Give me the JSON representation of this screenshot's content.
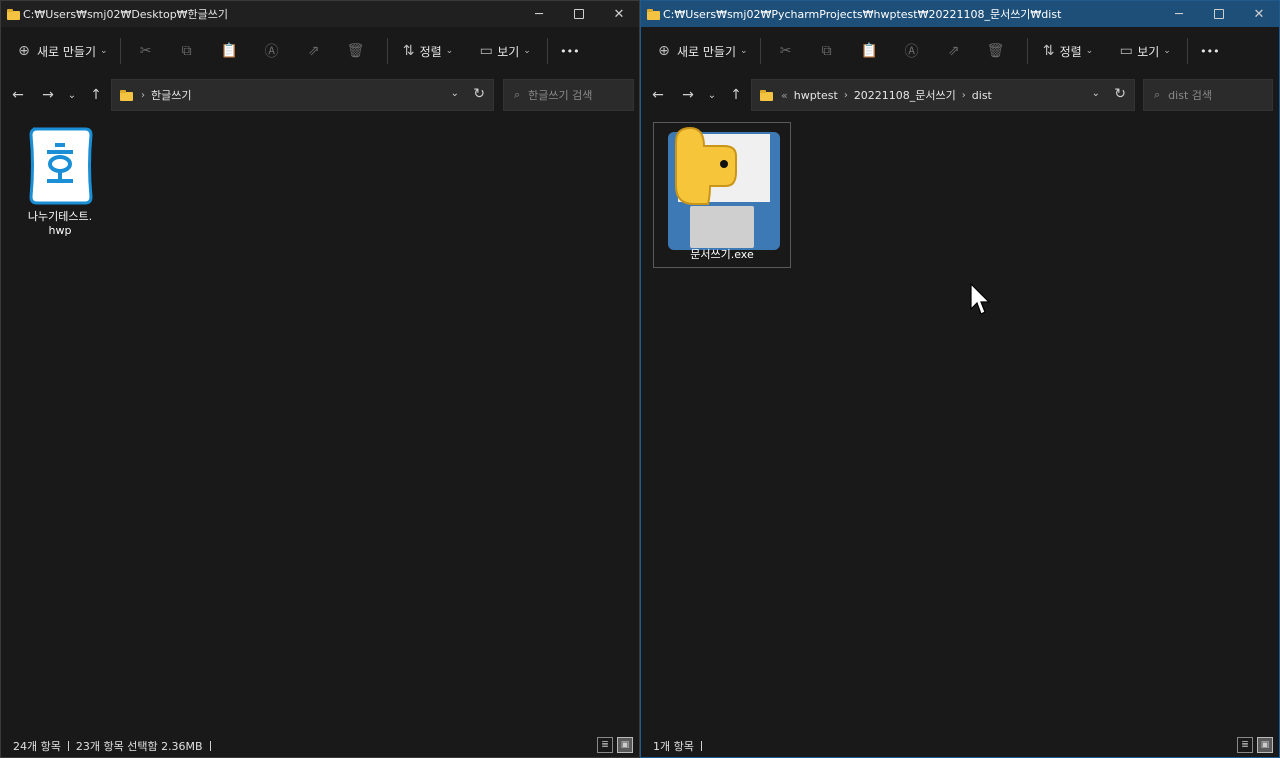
{
  "left_window": {
    "title": "C:₩Users₩smj02₩Desktop₩한글쓰기",
    "toolbar": {
      "new_label": "새로 만들기",
      "sort_label": "정렬",
      "view_label": "보기",
      "more_label": "•••"
    },
    "address": {
      "crumbs": [
        "한글쓰기"
      ]
    },
    "search": {
      "placeholder": "한글쓰기 검색"
    },
    "files": [
      {
        "name_line1": "나누기테스트.",
        "name_line2": "hwp",
        "icon": "hwp-file-icon"
      }
    ],
    "status": {
      "count": "24개 항목",
      "selected": "23개 항목 선택함 2.36MB"
    }
  },
  "right_window": {
    "title": "C:₩Users₩smj02₩PycharmProjects₩hwptest₩20221108_문서쓰기₩dist",
    "toolbar": {
      "new_label": "새로 만들기",
      "sort_label": "정렬",
      "view_label": "보기",
      "more_label": "•••"
    },
    "address": {
      "ellipsis": "«",
      "crumbs": [
        "hwptest",
        "20221108_문서쓰기",
        "dist"
      ]
    },
    "search": {
      "placeholder": "dist 검색"
    },
    "files": [
      {
        "name": "문서쓰기.exe",
        "icon": "python-exe-icon"
      }
    ],
    "status": {
      "count": "1개 항목"
    }
  },
  "glyphs": {
    "minimize": "─",
    "close": "✕",
    "back": "←",
    "forward": "→",
    "recent": "⌄",
    "up": "↑",
    "chev": "›",
    "refresh": "↻",
    "search": "⌕",
    "dropdown": "⌄",
    "cut": "✂",
    "copy": "⧉",
    "paste": "📋",
    "rename": "Ⓐ",
    "share": "⇗",
    "delete": "🗑",
    "sort": "⇅",
    "view": "▭",
    "new": "⊕",
    "details_view": "≣",
    "tiles_view": "▣"
  },
  "colors": {
    "bg": "#191919",
    "active_titlebar": "#1e4f79",
    "folder": "#f5c342",
    "hwp_blue": "#1a8fd6"
  }
}
